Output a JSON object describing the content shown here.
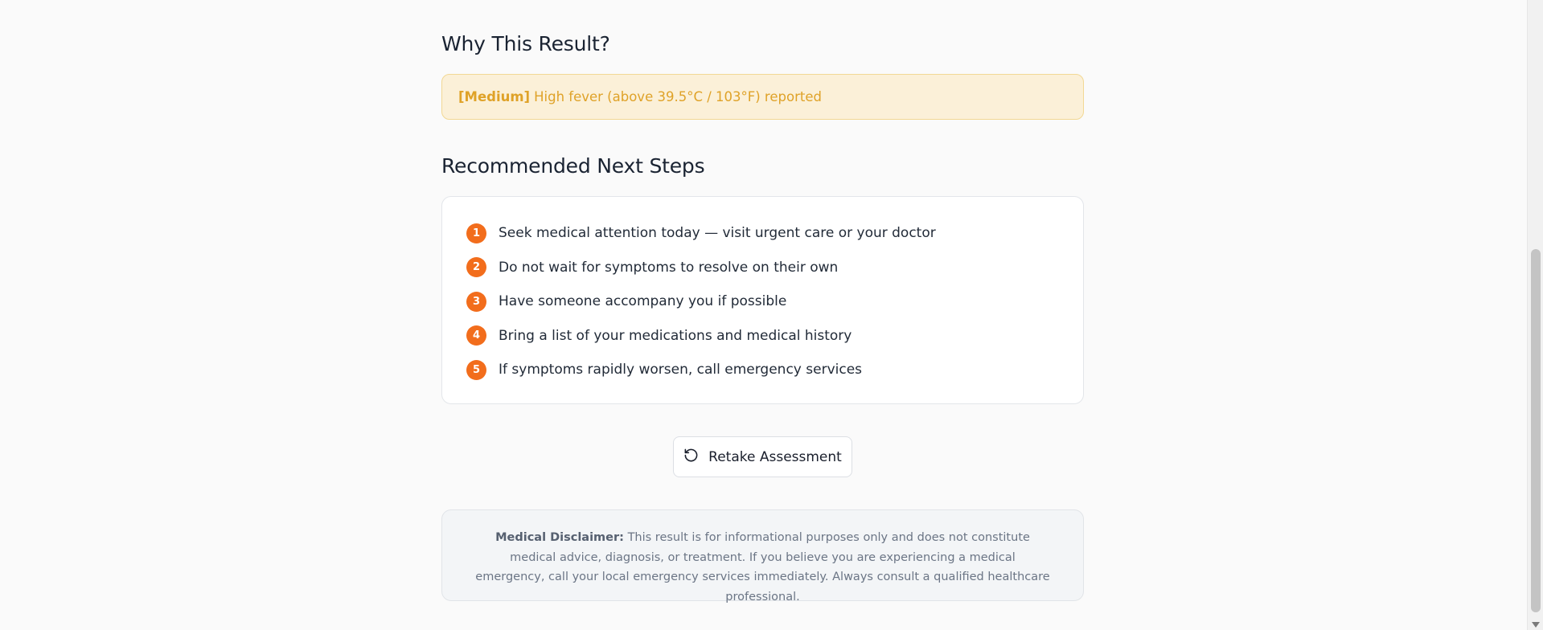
{
  "why": {
    "title": "Why This Result?",
    "severity": "[Medium]",
    "reason": "High fever (above 39.5°C / 103°F) reported"
  },
  "steps": {
    "title": "Recommended Next Steps",
    "items": [
      {
        "num": "1",
        "text": "Seek medical attention today — visit urgent care or your doctor"
      },
      {
        "num": "2",
        "text": "Do not wait for symptoms to resolve on their own"
      },
      {
        "num": "3",
        "text": "Have someone accompany you if possible"
      },
      {
        "num": "4",
        "text": "Bring a list of your medications and medical history"
      },
      {
        "num": "5",
        "text": "If symptoms rapidly worsen, call emergency services"
      }
    ]
  },
  "retake": {
    "label": "Retake Assessment",
    "icon": "rotate-ccw-icon"
  },
  "disclaimer": {
    "label": "Medical Disclaimer:",
    "text": "This result is for informational purposes only and does not constitute medical advice, diagnosis, or treatment. If you believe you are experiencing a medical emergency, call your local emergency services immediately. Always consult a qualified healthcare professional."
  },
  "colors": {
    "accent_orange": "#f26d1c",
    "warning_bg": "#fbf0d8",
    "warning_text": "#dfa228"
  }
}
